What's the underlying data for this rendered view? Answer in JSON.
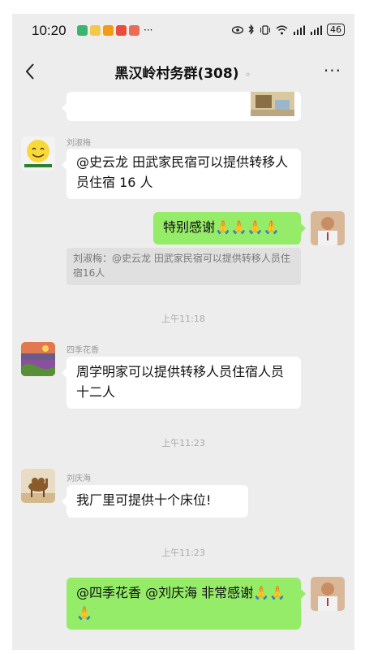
{
  "status_bar": {
    "time": "10:20",
    "more_dots": "···",
    "battery": "46"
  },
  "header": {
    "back_icon": "chevron-left-icon",
    "title": "黑汉岭村务群(308)",
    "more_icon": "more-dots-icon"
  },
  "messages": {
    "m1": {
      "sender": "刘淑梅",
      "text": "@史云龙  田武家民宿可以提供转移人员住宿 16 人"
    },
    "m2": {
      "text": "特别感谢🙏🙏🙏🙏",
      "quote": "刘淑梅：@史云龙 田武家民宿可以提供转移人员住宿16人"
    },
    "t1": "上午11:18",
    "m3": {
      "sender": "四季花香",
      "text": "周学明家可以提供转移人员住宿人员十二人"
    },
    "t2": "上午11:23",
    "m4": {
      "sender": "刘庆海",
      "text": "我厂里可提供十个床位!"
    },
    "t3": "上午11:23",
    "m5": {
      "text": "@四季花香 @刘庆海  非常感谢🙏🙏🙏"
    }
  },
  "colors": {
    "outgoing": "#95ec69",
    "incoming": "#ffffff",
    "background": "#ededed"
  }
}
